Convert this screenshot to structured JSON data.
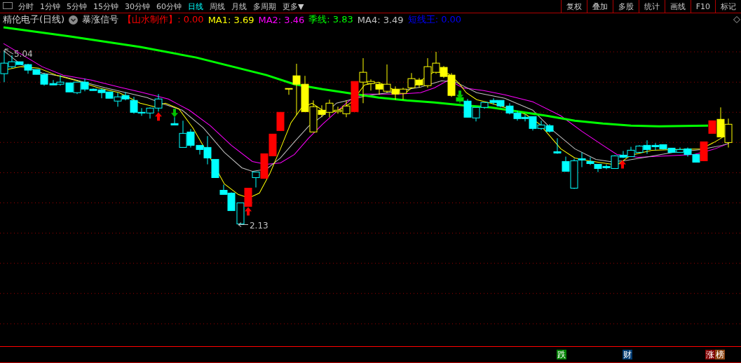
{
  "toolbar": {
    "tabs": [
      {
        "label": "分时",
        "selected": false
      },
      {
        "label": "1分钟",
        "selected": false
      },
      {
        "label": "5分钟",
        "selected": false
      },
      {
        "label": "15分钟",
        "selected": false
      },
      {
        "label": "30分钟",
        "selected": false
      },
      {
        "label": "60分钟",
        "selected": false
      },
      {
        "label": "日线",
        "selected": true
      },
      {
        "label": "周线",
        "selected": false
      },
      {
        "label": "月线",
        "selected": false
      },
      {
        "label": "多周期",
        "selected": false
      },
      {
        "label": "更多▼",
        "selected": false
      }
    ],
    "buttons": [
      "复权",
      "叠加",
      "多股",
      "统计",
      "画线",
      "F10",
      "标记"
    ]
  },
  "header": {
    "title": "精伦电子(日线)",
    "indicator": "暴涨信号",
    "legend": [
      {
        "text": "【山水制作】: 0.00",
        "color": "#ff0000"
      },
      {
        "text": "MA1: 3.69",
        "color": "#ffff00"
      },
      {
        "text": "MA2: 3.46",
        "color": "#ff00ff"
      },
      {
        "text": "季线: 3.83",
        "color": "#00ff00"
      },
      {
        "text": "MA4: 3.49",
        "color": "#c0c0c0"
      },
      {
        "text": "短线王: 0.00",
        "color": "#0000ff"
      }
    ]
  },
  "chart": {
    "high_label": "5.04",
    "low_label": "2.13"
  },
  "bottom_badges": [
    {
      "label": "跌",
      "color": "#008000"
    },
    {
      "label": "财",
      "color": "#003a70"
    },
    {
      "label": "涨",
      "color": "#800000"
    },
    {
      "label": "榜",
      "color": "#8b4513"
    }
  ]
}
